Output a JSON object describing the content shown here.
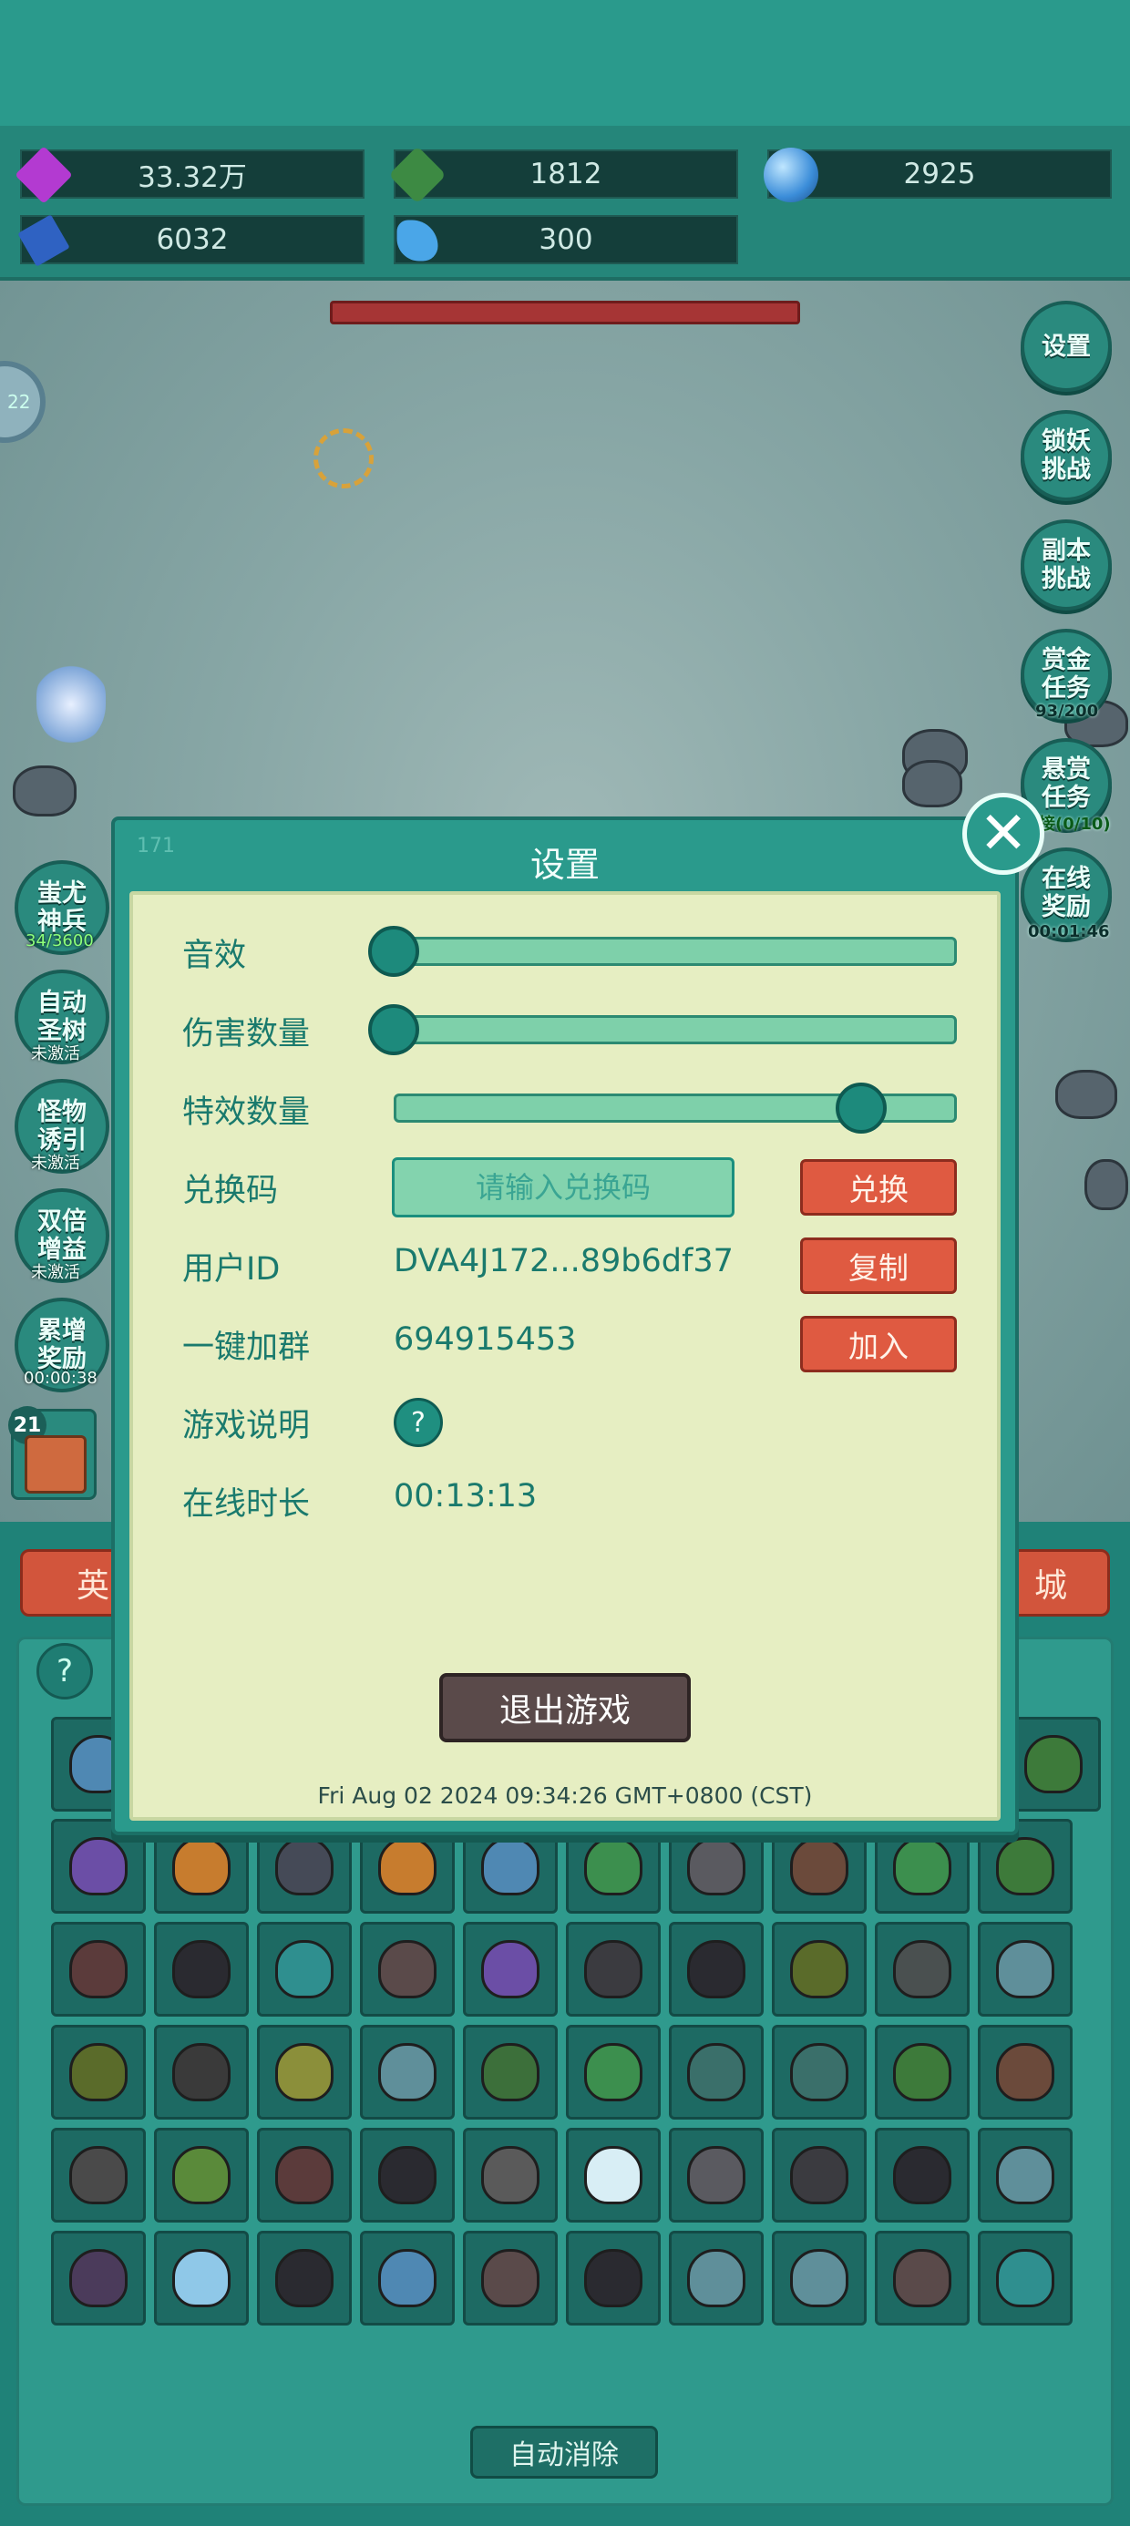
{
  "resources": [
    {
      "name": "gem",
      "value": "33.32万",
      "color": "#b33ad1"
    },
    {
      "name": "green-crystal",
      "value": "1812",
      "color": "#3d8a43"
    },
    {
      "name": "blue-orb",
      "value": "2925",
      "color": "#3b8dd9"
    },
    {
      "name": "book",
      "value": "6032",
      "color": "#2f62c2"
    },
    {
      "name": "blue-shard",
      "value": "300",
      "color": "#4aa6e8"
    }
  ],
  "left_circle_text": "22",
  "right_buttons": [
    {
      "label": "设置",
      "sub": ""
    },
    {
      "label": "锁妖挑战",
      "sub": ""
    },
    {
      "label": "副本挑战",
      "sub": ""
    },
    {
      "label": "赏金任务",
      "sub": "93/200"
    },
    {
      "label": "悬赏任务",
      "sub": "接(0/10)"
    },
    {
      "label": "在线奖励",
      "sub": "00:01:46"
    }
  ],
  "left_buttons": [
    {
      "label": "蚩尤神兵",
      "sub": "34/3600"
    },
    {
      "label": "自动圣树",
      "sub": "未激活"
    },
    {
      "label": "怪物诱引",
      "sub": "未激活"
    },
    {
      "label": "双倍增益",
      "sub": "未激活"
    },
    {
      "label": "累增奖励",
      "sub": "00:00:38"
    }
  ],
  "hero_card_level": "21",
  "tabs": {
    "left": "英",
    "right": "城"
  },
  "help_icon": "?",
  "auto_eliminate_label": "自动消除",
  "dialog": {
    "corner_number": "171",
    "title": "设置",
    "close_icon": "✕",
    "sound_label": "音效",
    "sound_value": 0.0,
    "damage_label": "伤害数量",
    "damage_value": 0.0,
    "effects_label": "特效数量",
    "effects_value": 0.83,
    "redeem_label": "兑换码",
    "redeem_placeholder": "请输入兑换码",
    "redeem_button": "兑换",
    "user_id_label": "用户ID",
    "user_id_value": "DVA4J172...89b6df37",
    "copy_button": "复制",
    "group_label": "一键加群",
    "group_value": "694915453",
    "join_button": "加入",
    "guide_label": "游戏说明",
    "guide_icon": "?",
    "online_label": "在线时长",
    "online_value": "00:13:13",
    "exit_button": "退出游戏",
    "timestamp": "Fri Aug 02 2024 09:34:26 GMT+0800 (CST)"
  },
  "grid_rows": [
    [
      "#6b4ea6",
      "#c77c2e",
      "#454a57",
      "#c77c2e",
      "#4f88b3",
      "#3c8f4e",
      "#5a5a60",
      "#6b4a3b",
      "#3c8f4e",
      "#3d7a3a"
    ],
    [
      "#5b3b3b",
      "#2a2a30",
      "#2f8f8f",
      "#5a4a4a",
      "#6b4ea6",
      "#3b3b40",
      "#2a2a30",
      "#5a6b2a",
      "#4a5050",
      "#5f8f9a"
    ],
    [
      "#5a6b2a",
      "#3a3a3a",
      "#8b8f3a",
      "#5f8f9a",
      "#3c6f3a",
      "#3c8f4e",
      "#3a6f6a",
      "#3a6f6a",
      "#3d7a3a",
      "#6b4a3b"
    ],
    [
      "#4a4a4a",
      "#5a8a3a",
      "#5b3b3b",
      "#2a2a30",
      "#5a5a5a",
      "#d8eef5",
      "#5a5a60",
      "#3b3b40",
      "#2a2a30",
      "#5f8f9a"
    ],
    [
      "#4b3b5b",
      "#8fc8e8",
      "#2a2a30",
      "#4f88b3",
      "#5a4a4a",
      "#2a2a30",
      "#5f8f9a",
      "#5f8f9a",
      "#5a4a4a",
      "#2f8f8f"
    ]
  ]
}
